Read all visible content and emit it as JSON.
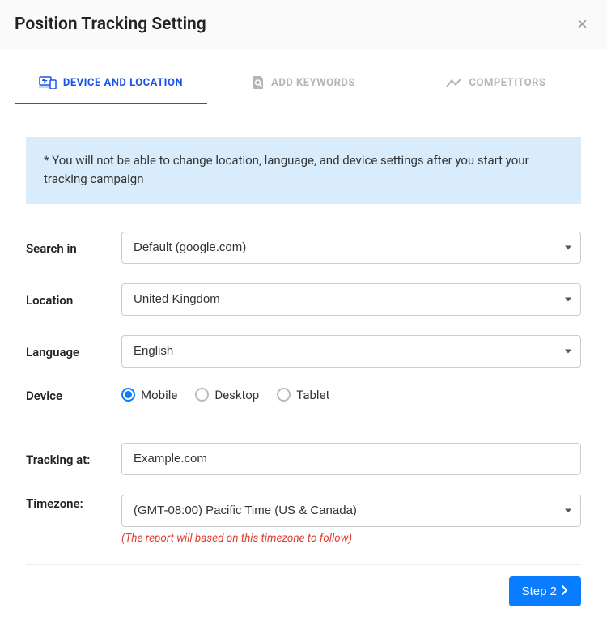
{
  "header": {
    "title": "Position Tracking Setting",
    "close": "×"
  },
  "tabs": {
    "device_location": "DEVICE AND LOCATION",
    "add_keywords": "ADD KEYWORDS",
    "competitors": "COMPETITORS"
  },
  "info_box": "* You will not be able to change location, language, and device settings after you start your tracking campaign",
  "form": {
    "search_in": {
      "label": "Search in",
      "value": "Default (google.com)"
    },
    "location": {
      "label": "Location",
      "value": "United Kingdom"
    },
    "language": {
      "label": "Language",
      "value": "English"
    },
    "device": {
      "label": "Device",
      "options": {
        "mobile": "Mobile",
        "desktop": "Desktop",
        "tablet": "Tablet"
      },
      "selected": "mobile"
    },
    "tracking_at": {
      "label": "Tracking at:",
      "value": "Example.com"
    },
    "timezone": {
      "label": "Timezone:",
      "value": "(GMT-08:00) Pacific Time (US & Canada)",
      "help": "(The report will based on this timezone to follow)"
    }
  },
  "footer": {
    "next": "Step 2"
  }
}
